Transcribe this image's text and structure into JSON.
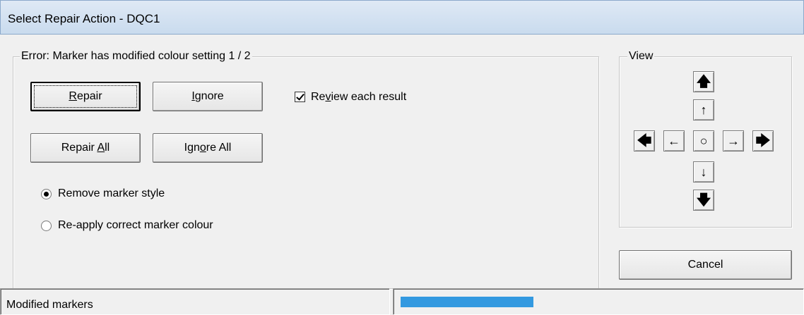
{
  "window": {
    "title": "Select Repair Action - DQC1"
  },
  "error_group": {
    "legend": "Error: Marker has modified colour setting  1 / 2"
  },
  "buttons": {
    "repair": {
      "pre": "",
      "accel": "R",
      "post": "epair"
    },
    "ignore": {
      "pre": "",
      "accel": "I",
      "post": "gnore"
    },
    "repair_all": {
      "pre": "Repair ",
      "accel": "A",
      "post": "ll"
    },
    "ignore_all": {
      "pre": "Ign",
      "accel": "o",
      "post": "re All"
    },
    "cancel": "Cancel"
  },
  "review_checkbox": {
    "pre": "Re",
    "accel": "v",
    "post": "iew each result",
    "checked": true
  },
  "options": [
    {
      "label": "Remove marker style",
      "selected": true
    },
    {
      "label": "Re-apply correct marker colour",
      "selected": false
    }
  ],
  "view_group": {
    "legend": "View",
    "buttons": {
      "up_fast": "🡅",
      "up": "↑",
      "left_fast": "🡄",
      "left": "←",
      "center": "○",
      "right": "→",
      "right_fast": "🡆",
      "down": "↓",
      "down_fast": "🡇"
    },
    "icons": {
      "up_fast": "up-bold-arrow-icon",
      "up": "up-arrow-icon",
      "left_fast": "left-bold-arrow-icon",
      "left": "left-arrow-icon",
      "center": "center-circle-icon",
      "right": "right-arrow-icon",
      "right_fast": "right-bold-arrow-icon",
      "down": "down-arrow-icon",
      "down_fast": "down-bold-arrow-icon"
    }
  },
  "status_bar": {
    "text": "Modified markers",
    "progress_fraction": 0.5,
    "progress_color": "#3399e0"
  }
}
